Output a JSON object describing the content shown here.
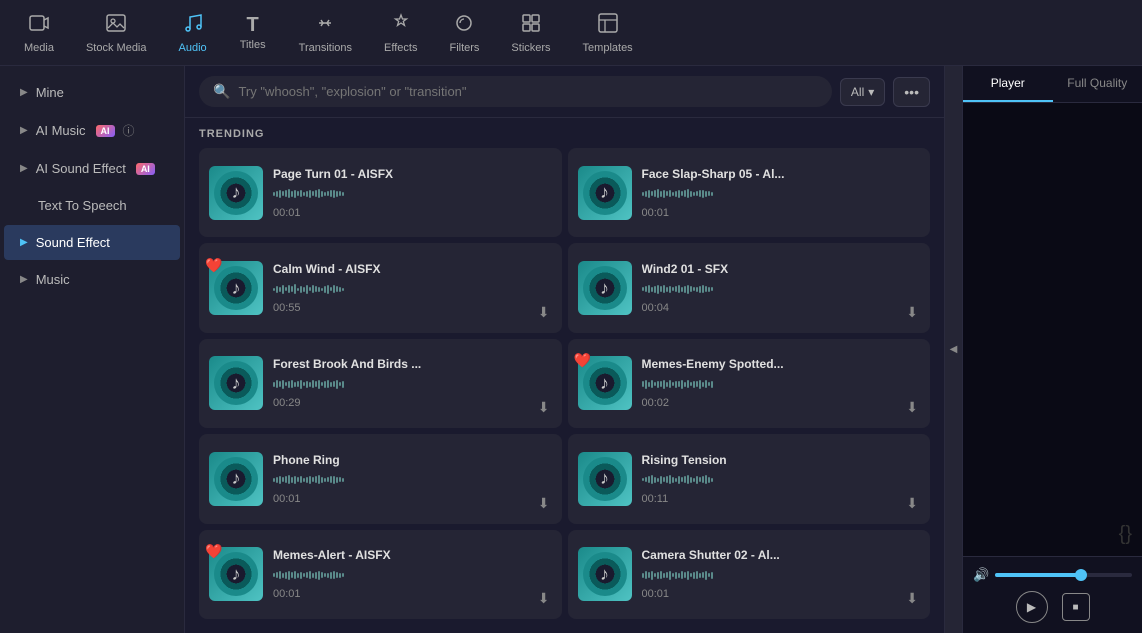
{
  "nav": {
    "items": [
      {
        "id": "media",
        "label": "Media",
        "icon": "🎞",
        "active": false
      },
      {
        "id": "stock-media",
        "label": "Stock Media",
        "icon": "🎬",
        "active": false
      },
      {
        "id": "audio",
        "label": "Audio",
        "icon": "🎵",
        "active": true
      },
      {
        "id": "titles",
        "label": "Titles",
        "icon": "T",
        "active": false
      },
      {
        "id": "transitions",
        "label": "Transitions",
        "icon": "↔",
        "active": false
      },
      {
        "id": "effects",
        "label": "Effects",
        "icon": "✨",
        "active": false
      },
      {
        "id": "filters",
        "label": "Filters",
        "icon": "🔮",
        "active": false
      },
      {
        "id": "stickers",
        "label": "Stickers",
        "icon": "⊕",
        "active": false
      },
      {
        "id": "templates",
        "label": "Templates",
        "icon": "▦",
        "active": false
      }
    ]
  },
  "sidebar": {
    "items": [
      {
        "id": "mine",
        "label": "Mine",
        "hasArrow": true,
        "active": false,
        "hasHeart": false
      },
      {
        "id": "ai-music",
        "label": "AI Music",
        "hasArrow": true,
        "active": false,
        "badge": "AI",
        "hasInfo": true
      },
      {
        "id": "ai-sound-effect",
        "label": "AI Sound Effect",
        "hasArrow": true,
        "active": false,
        "badge": "AI"
      },
      {
        "id": "text-to-speech",
        "label": "Text To Speech",
        "hasArrow": false,
        "active": false
      },
      {
        "id": "sound-effect",
        "label": "Sound Effect",
        "hasArrow": true,
        "active": true
      },
      {
        "id": "music",
        "label": "Music",
        "hasArrow": true,
        "active": false
      }
    ]
  },
  "search": {
    "placeholder": "Try \"whoosh\", \"explosion\" or \"transition\"",
    "filter_label": "All",
    "more_icon": "•••"
  },
  "trending": {
    "label": "TRENDING"
  },
  "audio_cards": [
    {
      "id": "page-turn",
      "title": "Page Turn 01 - AISFX",
      "duration": "00:01",
      "has_heart": false,
      "has_download": false,
      "wave_heights": [
        4,
        6,
        8,
        5,
        7,
        9,
        6,
        8,
        5,
        7,
        4,
        6,
        8,
        5,
        7,
        9,
        6,
        4,
        5,
        7,
        8,
        6,
        5,
        4
      ]
    },
    {
      "id": "face-slap",
      "title": "Face Slap-Sharp 05 - Al...",
      "duration": "00:01",
      "has_heart": false,
      "has_download": false,
      "wave_heights": [
        4,
        6,
        8,
        5,
        7,
        9,
        6,
        8,
        5,
        7,
        4,
        6,
        8,
        5,
        7,
        9,
        6,
        4,
        5,
        7,
        8,
        6,
        5,
        4
      ]
    },
    {
      "id": "calm-wind",
      "title": "Calm Wind - AISFX",
      "duration": "00:55",
      "has_heart": true,
      "has_download": true,
      "wave_heights": [
        3,
        7,
        5,
        9,
        4,
        8,
        6,
        10,
        3,
        7,
        5,
        9,
        4,
        8,
        6,
        5,
        3,
        7,
        9,
        4,
        8,
        6,
        5,
        3
      ]
    },
    {
      "id": "wind2",
      "title": "Wind2 01 - SFX",
      "duration": "00:04",
      "has_heart": false,
      "has_download": true,
      "wave_heights": [
        4,
        6,
        8,
        5,
        7,
        9,
        6,
        8,
        5,
        7,
        4,
        6,
        8,
        5,
        7,
        9,
        6,
        4,
        5,
        7,
        8,
        6,
        5,
        4
      ]
    },
    {
      "id": "forest-brook",
      "title": "Forest Brook And Birds ...",
      "duration": "00:29",
      "has_heart": false,
      "has_download": true,
      "wave_heights": [
        5,
        8,
        6,
        9,
        4,
        7,
        8,
        5,
        6,
        9,
        4,
        7,
        5,
        8,
        6,
        9,
        4,
        7,
        8,
        5,
        6,
        9,
        4,
        7
      ]
    },
    {
      "id": "memes-enemy",
      "title": "Memes-Enemy Spotted...",
      "duration": "00:02",
      "has_heart": true,
      "has_download": true,
      "wave_heights": [
        6,
        9,
        5,
        8,
        4,
        7,
        6,
        9,
        5,
        8,
        4,
        7,
        6,
        9,
        5,
        8,
        4,
        7,
        6,
        9,
        5,
        8,
        4,
        7
      ]
    },
    {
      "id": "phone-ring",
      "title": "Phone Ring",
      "duration": "00:01",
      "has_heart": false,
      "has_download": true,
      "wave_heights": [
        4,
        6,
        8,
        5,
        7,
        9,
        6,
        8,
        5,
        7,
        4,
        6,
        8,
        5,
        7,
        9,
        6,
        4,
        5,
        7,
        8,
        6,
        5,
        4
      ]
    },
    {
      "id": "rising-tension",
      "title": "Rising Tension",
      "duration": "00:11",
      "has_heart": false,
      "has_download": true,
      "wave_heights": [
        3,
        5,
        7,
        9,
        6,
        4,
        8,
        5,
        7,
        9,
        6,
        4,
        8,
        5,
        7,
        9,
        6,
        4,
        8,
        5,
        7,
        9,
        6,
        4
      ]
    },
    {
      "id": "memes-alert",
      "title": "Memes-Alert - AISFX",
      "duration": "00:01",
      "has_heart": true,
      "has_download": true,
      "wave_heights": [
        4,
        6,
        8,
        5,
        7,
        9,
        6,
        8,
        5,
        7,
        4,
        6,
        8,
        5,
        7,
        9,
        6,
        4,
        5,
        7,
        8,
        6,
        5,
        4
      ]
    },
    {
      "id": "camera-shutter",
      "title": "Camera Shutter 02 - Al...",
      "duration": "00:01",
      "has_heart": false,
      "has_download": true,
      "wave_heights": [
        5,
        8,
        6,
        9,
        4,
        7,
        8,
        5,
        6,
        9,
        4,
        7,
        5,
        8,
        6,
        9,
        4,
        7,
        8,
        5,
        6,
        9,
        4,
        7
      ]
    }
  ],
  "player": {
    "tab_player": "Player",
    "tab_quality": "Full Quality",
    "volume_pct": 60,
    "play_icon": "▶",
    "stop_icon": "■"
  }
}
